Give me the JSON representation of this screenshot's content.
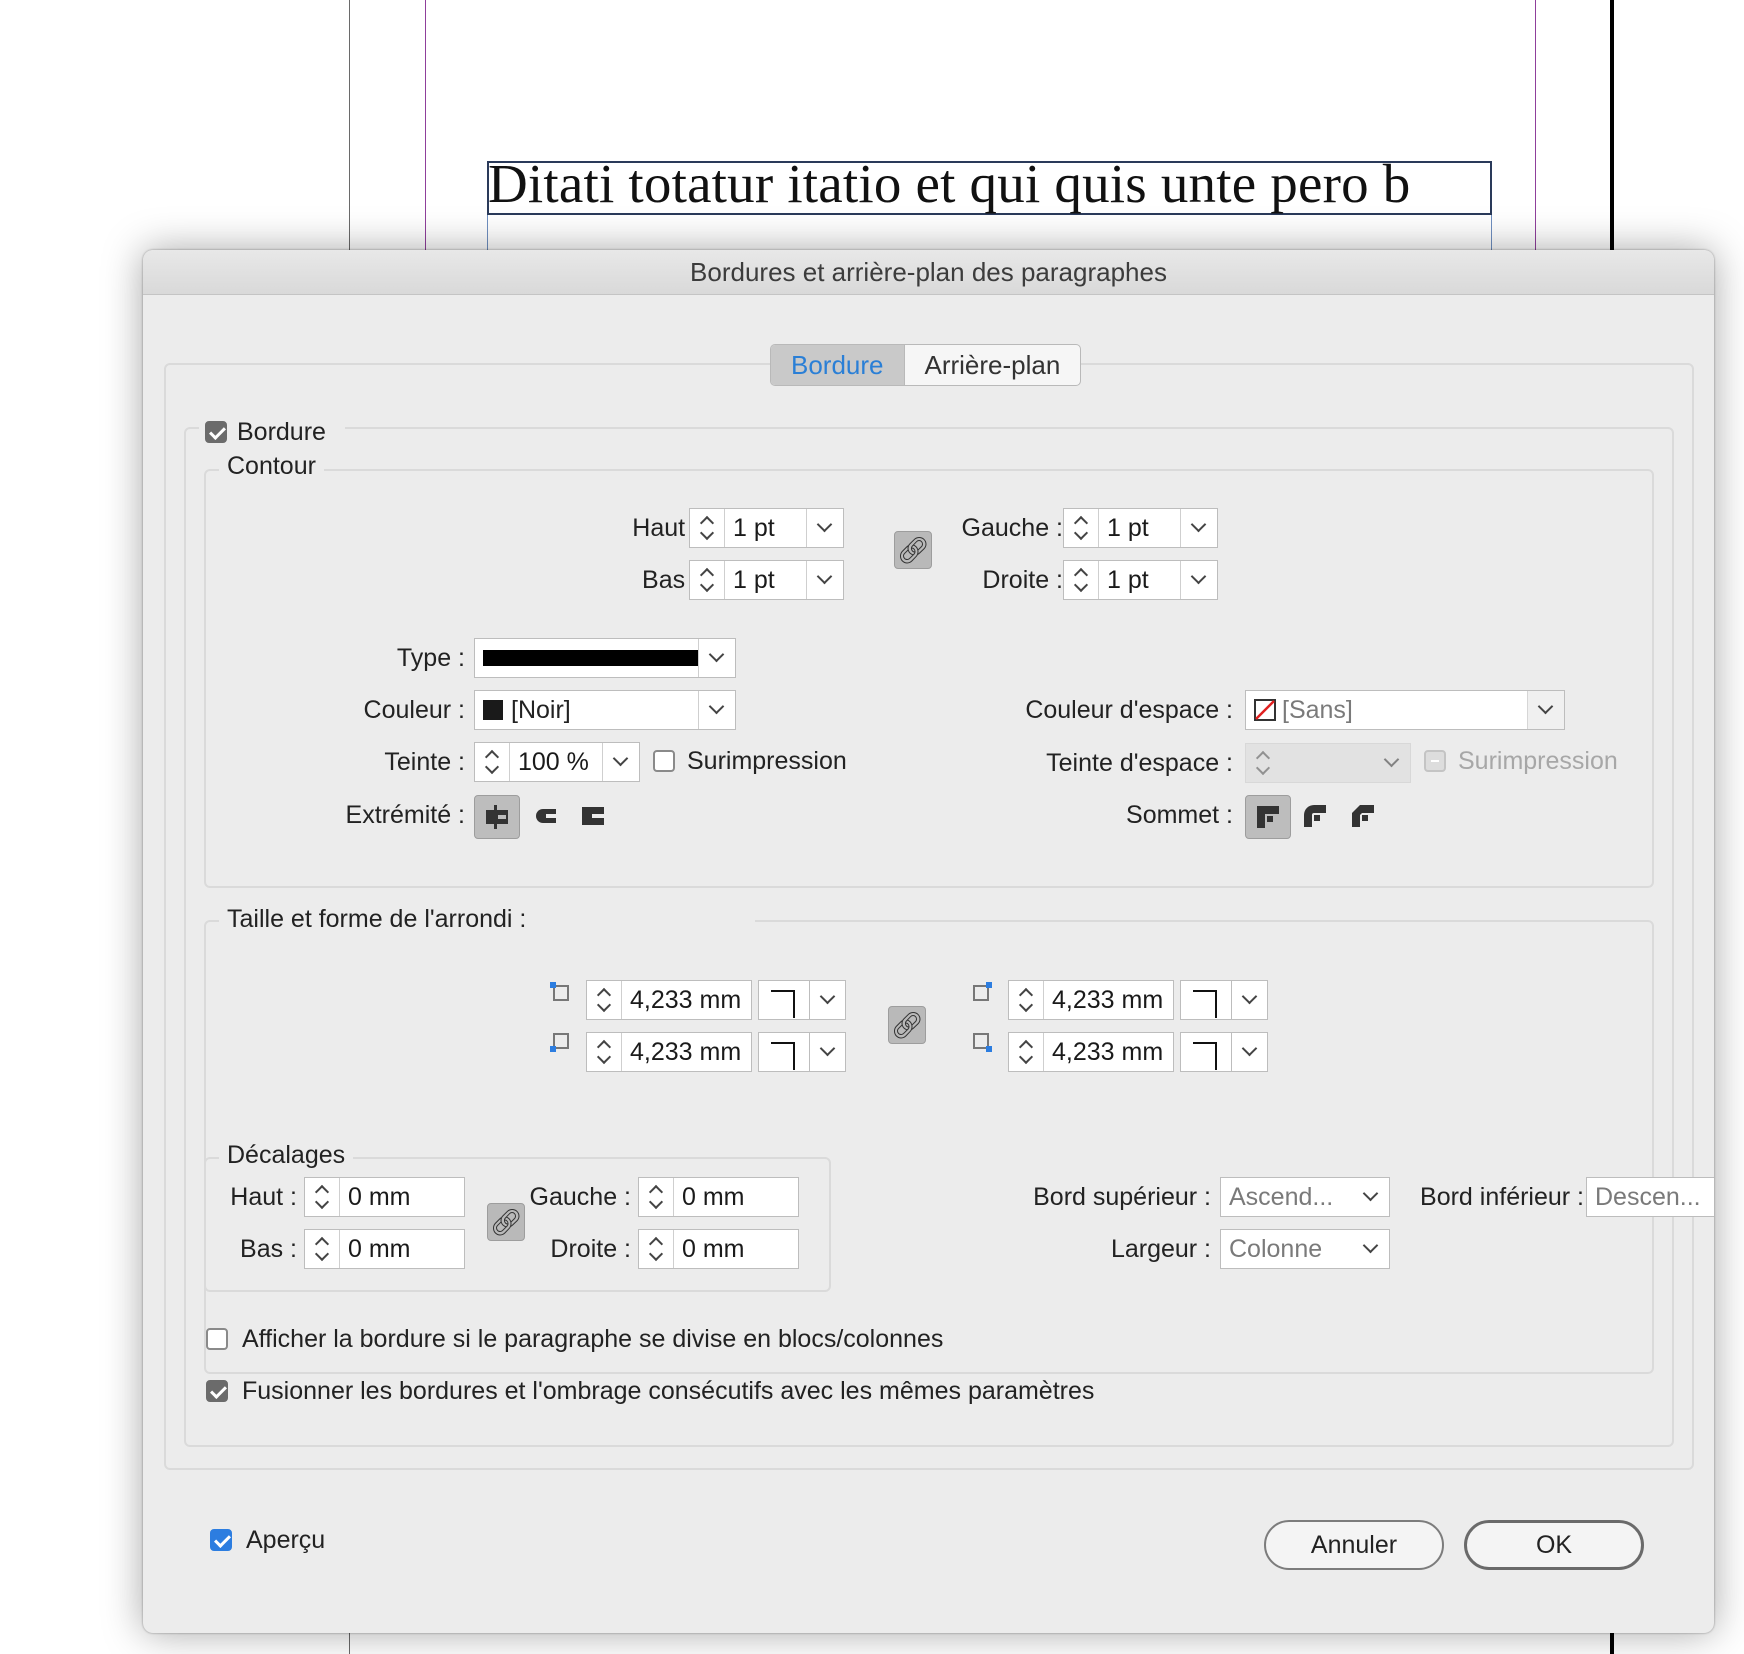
{
  "document": {
    "text": "Ditati totatur itatio et qui quis unte pero b"
  },
  "dialog": {
    "title": "Bordures et arrière-plan des paragraphes",
    "tabs": [
      {
        "label": "Bordure",
        "active": true
      },
      {
        "label": "Arrière-plan",
        "active": false
      }
    ],
    "border_checkbox": {
      "label": "Bordure",
      "checked": true
    },
    "contour": {
      "title": "Contour",
      "haut_label": "Haut :",
      "haut_value": "1 pt",
      "bas_label": "Bas :",
      "bas_value": "1 pt",
      "gauche_label": "Gauche :",
      "gauche_value": "1 pt",
      "droite_label": "Droite :",
      "droite_value": "1 pt",
      "type_label": "Type :",
      "couleur_label": "Couleur :",
      "couleur_value": "[Noir]",
      "teinte_label": "Teinte :",
      "teinte_value": "100 %",
      "surimpression_label": "Surimpression",
      "surimpression_checked": false,
      "couleur_espace_label": "Couleur d'espace :",
      "couleur_espace_value": "[Sans]",
      "teinte_espace_label": "Teinte d'espace :",
      "teinte_espace_value": "",
      "surimpression_espace_label": "Surimpression",
      "extremite_label": "Extrémité :",
      "sommet_label": "Sommet :"
    },
    "corners": {
      "title": "Taille et forme de l'arrondi :",
      "top_left": "4,233 mm",
      "bottom_left": "4,233 mm",
      "top_right": "4,233 mm",
      "bottom_right": "4,233 mm"
    },
    "offsets": {
      "title": "Décalages",
      "haut_label": "Haut :",
      "haut_value": "0 mm",
      "bas_label": "Bas :",
      "bas_value": "0 mm",
      "gauche_label": "Gauche :",
      "gauche_value": "0 mm",
      "droite_label": "Droite :",
      "droite_value": "0 mm",
      "bord_sup_label": "Bord supérieur :",
      "bord_sup_value": "Ascend...",
      "bord_inf_label": "Bord inférieur :",
      "bord_inf_value": "Descen...",
      "largeur_label": "Largeur :",
      "largeur_value": "Colonne"
    },
    "options": {
      "split_label": "Afficher la bordure si le paragraphe se divise en blocs/colonnes",
      "split_checked": false,
      "merge_label": "Fusionner les bordures et l'ombrage consécutifs avec les mêmes paramètres",
      "merge_checked": true
    },
    "preview": {
      "label": "Aperçu",
      "checked": true
    },
    "buttons": {
      "cancel": "Annuler",
      "ok": "OK"
    }
  },
  "colors": {
    "accent": "#2c7de0",
    "tab_active_text": "#2a7fd6",
    "guide": "#8f3f9b"
  }
}
